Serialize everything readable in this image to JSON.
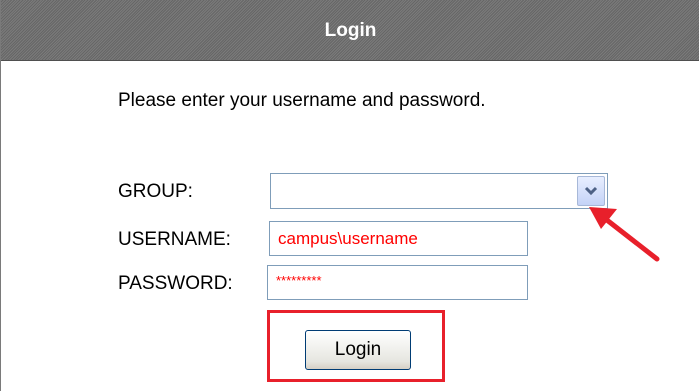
{
  "window": {
    "title": "Login"
  },
  "form": {
    "intro": "Please enter your username and password.",
    "group_label": "GROUP:",
    "group_value": "",
    "username_label": "USERNAME:",
    "username_value": "campus\\username",
    "password_label": "PASSWORD:",
    "password_value": "*********",
    "login_label": "Login"
  },
  "colors": {
    "title_bar": "#6e6e6e",
    "input_text": "#ff0000",
    "annotation": "#e8202b"
  },
  "icons": {
    "dropdown": "chevron-down-icon",
    "annotation": "arrow-icon"
  }
}
